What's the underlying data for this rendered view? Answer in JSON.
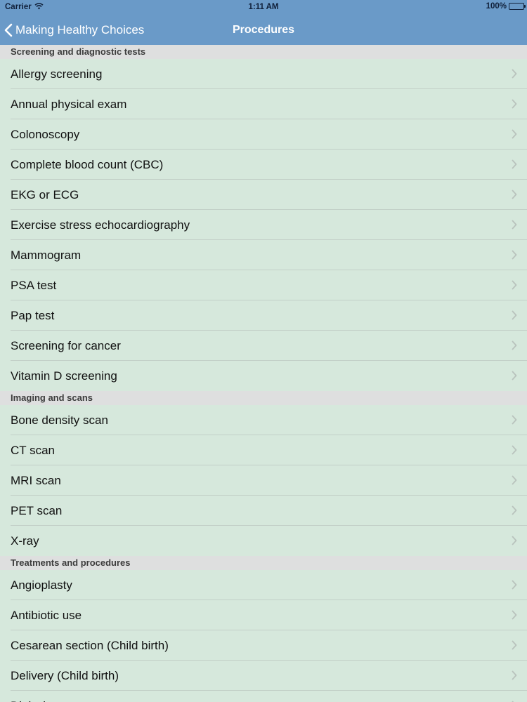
{
  "status_bar": {
    "carrier": "Carrier",
    "time": "1:11 AM",
    "battery": "100%",
    "battery_level": 1.0
  },
  "nav": {
    "back_label": "Making Healthy Choices",
    "title": "Procedures"
  },
  "sections": [
    {
      "header": "Screening and diagnostic tests",
      "items": [
        "Allergy screening",
        "Annual physical exam",
        "Colonoscopy",
        "Complete blood count (CBC)",
        "EKG or ECG",
        "Exercise stress echocardiography",
        "Mammogram",
        "PSA test",
        "Pap test",
        "Screening for cancer",
        "Vitamin D screening"
      ]
    },
    {
      "header": "Imaging and scans",
      "items": [
        "Bone density scan",
        "CT scan",
        "MRI scan",
        "PET scan",
        "X-ray"
      ]
    },
    {
      "header": "Treatments and procedures",
      "items": [
        "Angioplasty",
        "Antibiotic use",
        "Cesarean section (Child birth)",
        "Delivery (Child birth)",
        "Dialysis"
      ]
    }
  ],
  "icons": {
    "back": "chevron-left-icon",
    "row_accessory": "chevron-right-icon",
    "wifi": "wifi-icon",
    "battery": "battery-icon"
  },
  "colors": {
    "nav_bar": "#6a9ac8",
    "list_background": "#d6e8dc",
    "section_header": "#dedfdf",
    "chevron": "#b9c3bd"
  }
}
